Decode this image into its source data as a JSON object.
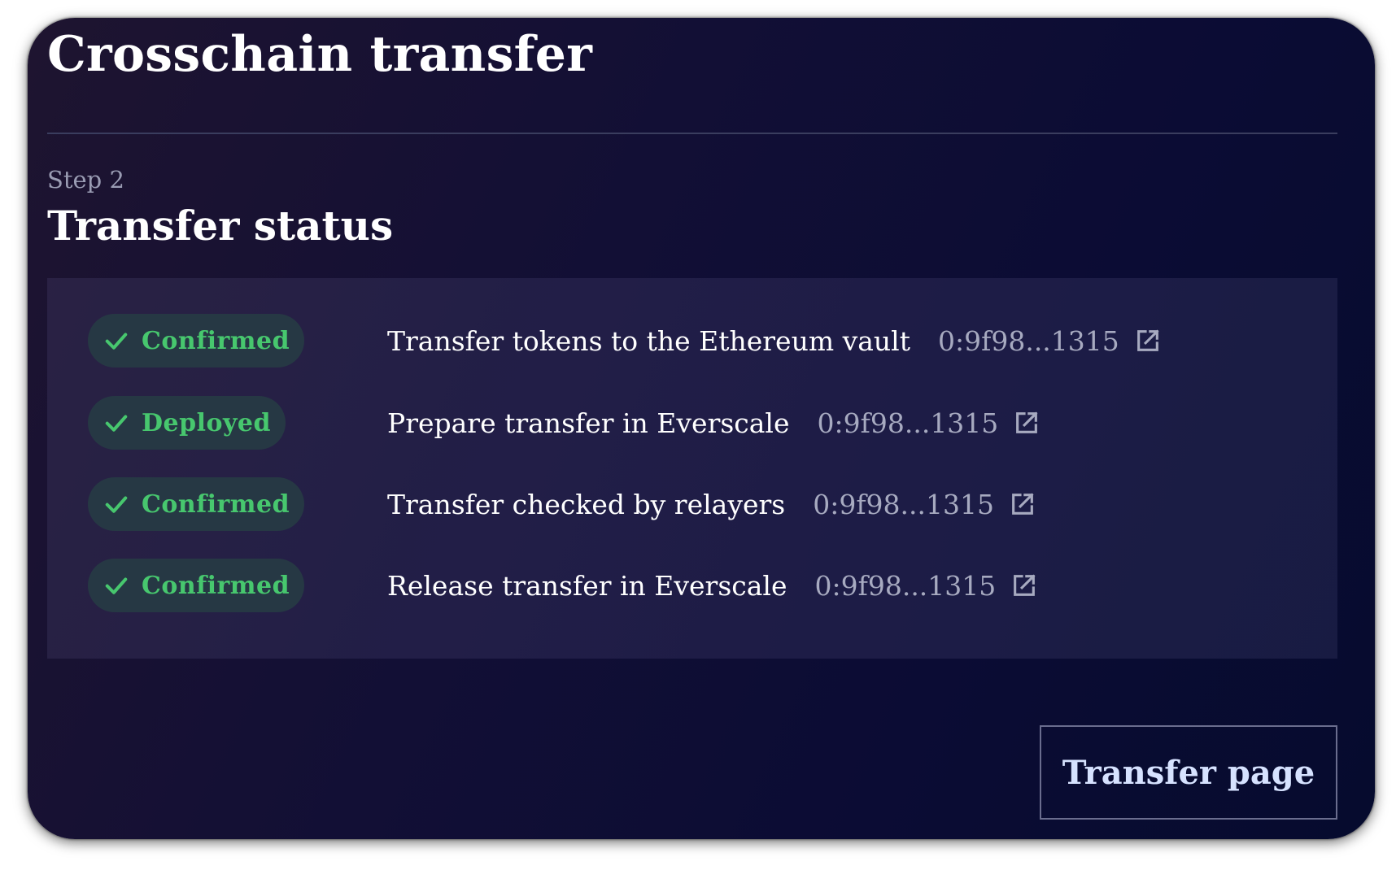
{
  "header": {
    "title": "Crosschain transfer"
  },
  "step": {
    "label": "Step 2",
    "title": "Transfer status"
  },
  "colors": {
    "success_green": "#47c76e",
    "badge_bg": "#263844",
    "card_bg": "#0b0c34",
    "panel_bg": "#28243f"
  },
  "steps": [
    {
      "status": "Confirmed",
      "status_icon": "check-icon",
      "description": "Transfer tokens to the Ethereum vault",
      "tx_hash": "0:9f98...1315",
      "link_icon": "external-link-icon"
    },
    {
      "status": "Deployed",
      "status_icon": "check-icon",
      "description": "Prepare transfer in Everscale",
      "tx_hash": "0:9f98...1315",
      "link_icon": "external-link-icon"
    },
    {
      "status": "Confirmed",
      "status_icon": "check-icon",
      "description": "Transfer checked by relayers",
      "tx_hash": "0:9f98...1315",
      "link_icon": "external-link-icon"
    },
    {
      "status": "Confirmed",
      "status_icon": "check-icon",
      "description": "Release transfer in Everscale",
      "tx_hash": "0:9f98...1315",
      "link_icon": "external-link-icon"
    }
  ],
  "actions": {
    "transfer_page_label": "Transfer page"
  }
}
